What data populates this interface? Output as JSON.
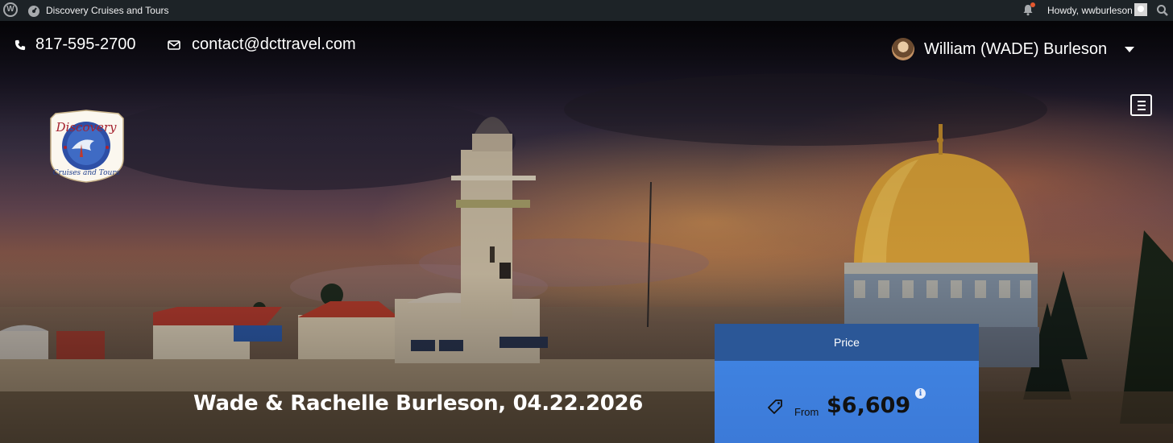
{
  "admin_bar": {
    "site_name": "Discovery Cruises and Tours",
    "greeting": "Howdy, wwburleson"
  },
  "topbar": {
    "phone": "817-595-2700",
    "email": "contact@dcttravel.com",
    "user_name": "William (WADE) Burleson"
  },
  "logo": {
    "line1": "Discovery",
    "line2": "Cruises and Tours"
  },
  "trip": {
    "title": "Wade & Rachelle Burleson, 04.22.2026"
  },
  "price": {
    "header": "Price",
    "from_label": "From",
    "amount": "$6,609",
    "info_symbol": "i"
  },
  "colors": {
    "admin_bar_bg": "#1d2327",
    "price_header_bg": "#2b5797",
    "price_body_bg": "#3c7ad8",
    "dome_gold": "#e0a63a"
  },
  "icons": [
    "wordpress-icon",
    "dashboard-icon",
    "bell-icon",
    "search-icon",
    "phone-icon",
    "mail-icon",
    "chevron-down-icon",
    "menu-icon",
    "price-tag-icon",
    "info-icon"
  ]
}
